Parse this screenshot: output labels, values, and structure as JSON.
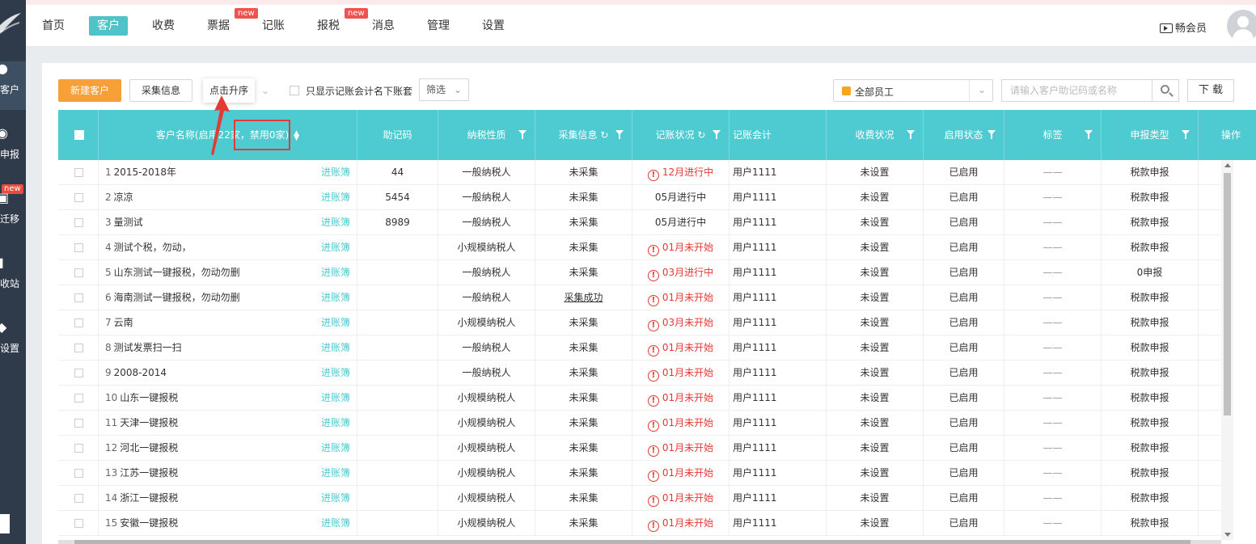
{
  "sidebar": {
    "items": [
      {
        "label": "客户",
        "icon": "user-icon"
      },
      {
        "label": "申报",
        "icon": "declare-icon"
      },
      {
        "label": "迁移",
        "icon": "migrate-icon",
        "badge": "new"
      },
      {
        "label": "回收站",
        "icon": "trash-icon"
      },
      {
        "label": "设置",
        "icon": "settings-icon"
      }
    ]
  },
  "topnav": {
    "items": [
      {
        "label": "首页"
      },
      {
        "label": "客户",
        "active": true
      },
      {
        "label": "收费"
      },
      {
        "label": "票据",
        "badge": "new"
      },
      {
        "label": "记账"
      },
      {
        "label": "报税",
        "badge": "new"
      },
      {
        "label": "消息"
      },
      {
        "label": "管理"
      },
      {
        "label": "设置"
      }
    ],
    "member_label": "畅会员"
  },
  "toolbar": {
    "new_customer": "新建客户",
    "collect_info": "采集信息",
    "tooltip": "点击升序",
    "only_show_label": "只显示记账会计名下账套",
    "filter_label": "筛选",
    "employee_select": "全部员工",
    "search_placeholder": "请输入客户助记码或名称",
    "download": "下 载"
  },
  "table": {
    "headers": {
      "name": "客户名称(启用22家，禁用0家)",
      "code": "助记码",
      "tax_type": "纳税性质",
      "collect": "采集信息",
      "book_status": "记账状况",
      "accountant": "记账会计",
      "fee_status": "收费状况",
      "enable_status": "启用状态",
      "tag": "标签",
      "declare_type": "申报类型",
      "action": "操作"
    },
    "link_label": "进账簿",
    "rows": [
      {
        "no": "1",
        "name": "2015-2018年",
        "code": "44",
        "tax": "一般纳税人",
        "collect": "未采集",
        "status": "12月进行中",
        "warn": true,
        "acct": "用户1111",
        "fee": "未设置",
        "enabled": "已启用",
        "tag": "——",
        "declare": "税款申报"
      },
      {
        "no": "2",
        "name": "凉凉",
        "code": "5454",
        "tax": "一般纳税人",
        "collect": "未采集",
        "status": "05月进行中",
        "warn": false,
        "acct": "用户1111",
        "fee": "未设置",
        "enabled": "已启用",
        "tag": "——",
        "declare": "税款申报"
      },
      {
        "no": "3",
        "name": "量测试",
        "code": "8989",
        "tax": "一般纳税人",
        "collect": "未采集",
        "status": "05月进行中",
        "warn": false,
        "acct": "用户1111",
        "fee": "未设置",
        "enabled": "已启用",
        "tag": "——",
        "declare": "税款申报"
      },
      {
        "no": "4",
        "name": "测试个税，勿动，",
        "code": "",
        "tax": "小规模纳税人",
        "collect": "未采集",
        "status": "01月未开始",
        "warn": true,
        "acct": "用户1111",
        "fee": "未设置",
        "enabled": "已启用",
        "tag": "——",
        "declare": "税款申报"
      },
      {
        "no": "5",
        "name": "山东测试一键报税，勿动勿删",
        "code": "",
        "tax": "一般纳税人",
        "collect": "未采集",
        "status": "03月进行中",
        "warn": true,
        "acct": "用户1111",
        "fee": "未设置",
        "enabled": "已启用",
        "tag": "——",
        "declare": "0申报"
      },
      {
        "no": "6",
        "name": "海南测试一键报税，勿动勿删",
        "code": "",
        "tax": "一般纳税人",
        "collect": "采集成功",
        "collect_link": true,
        "status": "01月未开始",
        "warn": true,
        "acct": "用户1111",
        "fee": "未设置",
        "enabled": "已启用",
        "tag": "——",
        "declare": "税款申报"
      },
      {
        "no": "7",
        "name": "云南",
        "code": "",
        "tax": "小规模纳税人",
        "collect": "未采集",
        "status": "03月未开始",
        "warn": true,
        "acct": "用户1111",
        "fee": "未设置",
        "enabled": "已启用",
        "tag": "——",
        "declare": "税款申报"
      },
      {
        "no": "8",
        "name": "测试发票扫一扫",
        "code": "",
        "tax": "一般纳税人",
        "collect": "未采集",
        "status": "01月未开始",
        "warn": true,
        "acct": "用户1111",
        "fee": "未设置",
        "enabled": "已启用",
        "tag": "——",
        "declare": "税款申报"
      },
      {
        "no": "9",
        "name": "2008-2014",
        "code": "",
        "tax": "一般纳税人",
        "collect": "未采集",
        "status": "01月未开始",
        "warn": true,
        "acct": "用户1111",
        "fee": "未设置",
        "enabled": "已启用",
        "tag": "——",
        "declare": "税款申报"
      },
      {
        "no": "10",
        "name": "山东一键报税",
        "code": "",
        "tax": "小规模纳税人",
        "collect": "未采集",
        "status": "01月未开始",
        "warn": true,
        "acct": "用户1111",
        "fee": "未设置",
        "enabled": "已启用",
        "tag": "——",
        "declare": "税款申报"
      },
      {
        "no": "11",
        "name": "天津一键报税",
        "code": "",
        "tax": "小规模纳税人",
        "collect": "未采集",
        "status": "01月未开始",
        "warn": true,
        "acct": "用户1111",
        "fee": "未设置",
        "enabled": "已启用",
        "tag": "——",
        "declare": "税款申报"
      },
      {
        "no": "12",
        "name": "河北一键报税",
        "code": "",
        "tax": "小规模纳税人",
        "collect": "未采集",
        "status": "01月未开始",
        "warn": true,
        "acct": "用户1111",
        "fee": "未设置",
        "enabled": "已启用",
        "tag": "——",
        "declare": "税款申报"
      },
      {
        "no": "13",
        "name": "江苏一键报税",
        "code": "",
        "tax": "小规模纳税人",
        "collect": "未采集",
        "status": "01月未开始",
        "warn": true,
        "acct": "用户1111",
        "fee": "未设置",
        "enabled": "已启用",
        "tag": "——",
        "declare": "税款申报"
      },
      {
        "no": "14",
        "name": "浙江一键报税",
        "code": "",
        "tax": "小规模纳税人",
        "collect": "未采集",
        "status": "01月未开始",
        "warn": true,
        "acct": "用户1111",
        "fee": "未设置",
        "enabled": "已启用",
        "tag": "——",
        "declare": "税款申报"
      },
      {
        "no": "15",
        "name": "安徽一键报税",
        "code": "",
        "tax": "小规模纳税人",
        "collect": "未采集",
        "status": "01月未开始",
        "warn": true,
        "acct": "用户1111",
        "fee": "未设置",
        "enabled": "已启用",
        "tag": "——",
        "declare": "税款申报"
      }
    ]
  },
  "colors": {
    "accent": "#4ecbd1",
    "orange": "#f7a038",
    "warn": "#e53935",
    "sidebar": "#2f3b4a"
  }
}
